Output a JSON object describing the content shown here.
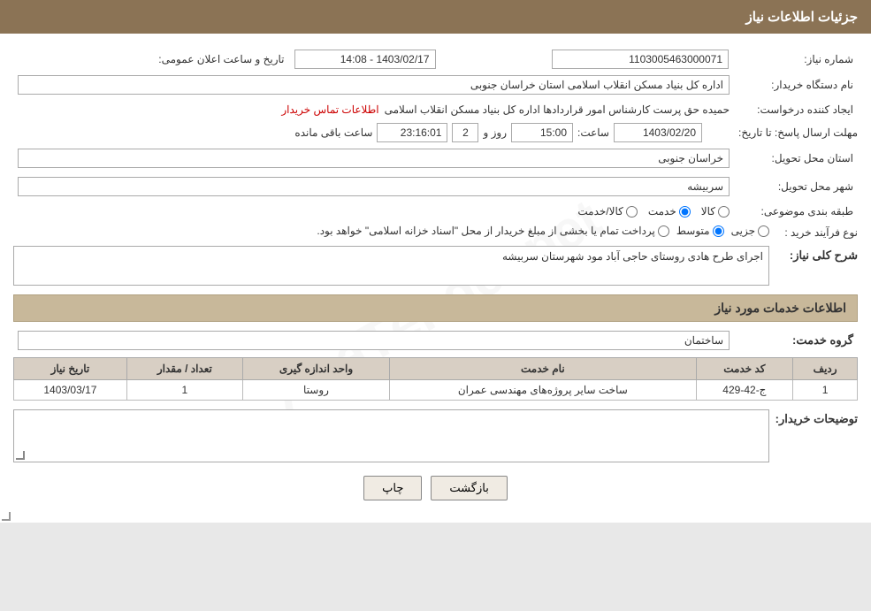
{
  "header": {
    "title": "جزئیات اطلاعات نیاز"
  },
  "fields": {
    "need_number_label": "شماره نیاز:",
    "need_number_value": "1103005463000071",
    "announce_datetime_label": "تاریخ و ساعت اعلان عمومی:",
    "announce_datetime_value": "1403/02/17 - 14:08",
    "buyer_name_label": "نام دستگاه خریدار:",
    "buyer_name_value": "اداره کل بنیاد مسکن انقلاب اسلامی استان خراسان جنوبی",
    "creator_label": "ایجاد کننده درخواست:",
    "creator_value": "حمیده حق پرست کارشناس امور قراردادها اداره کل بنیاد مسکن انقلاب اسلامی",
    "contact_link": "اطلاعات تماس خریدار",
    "response_deadline_label": "مهلت ارسال پاسخ: تا تاریخ:",
    "deadline_date": "1403/02/20",
    "deadline_time_label": "ساعت:",
    "deadline_time": "15:00",
    "remaining_days_label": "روز و",
    "remaining_days": "2",
    "remaining_time": "23:16:01",
    "remaining_suffix": "ساعت باقی مانده",
    "province_label": "استان محل تحویل:",
    "province_value": "خراسان جنوبی",
    "city_label": "شهر محل تحویل:",
    "city_value": "سربیشه",
    "category_label": "طبقه بندی موضوعی:",
    "category_options": [
      "کالا",
      "خدمت",
      "کالا/خدمت"
    ],
    "category_selected": "خدمت",
    "process_label": "نوع فرآیند خرید :",
    "process_options": [
      "جزیی",
      "متوسط",
      "پرداخت تمام یا بخشی از مبلغ خریدار از محل \"اسناد خزانه اسلامی\" خواهد بود."
    ],
    "process_selected": "متوسط",
    "need_description_label": "شرح کلی نیاز:",
    "need_description_value": "اجرای طرح هادی روستای حاجی آباد مود شهرستان سربیشه",
    "services_section_title": "اطلاعات خدمات مورد نیاز",
    "service_group_label": "گروه خدمت:",
    "service_group_value": "ساختمان",
    "table_headers": [
      "ردیف",
      "کد خدمت",
      "نام خدمت",
      "واحد اندازه گیری",
      "تعداد / مقدار",
      "تاریخ نیاز"
    ],
    "table_rows": [
      {
        "row": "1",
        "code": "ج-42-429",
        "name": "ساخت سایر پروژه‌های مهندسی عمران",
        "unit": "روستا",
        "quantity": "1",
        "date": "1403/03/17"
      }
    ],
    "buyer_desc_label": "توضیحات خریدار:",
    "buyer_desc_value": "",
    "btn_back": "بازگشت",
    "btn_print": "چاپ"
  }
}
